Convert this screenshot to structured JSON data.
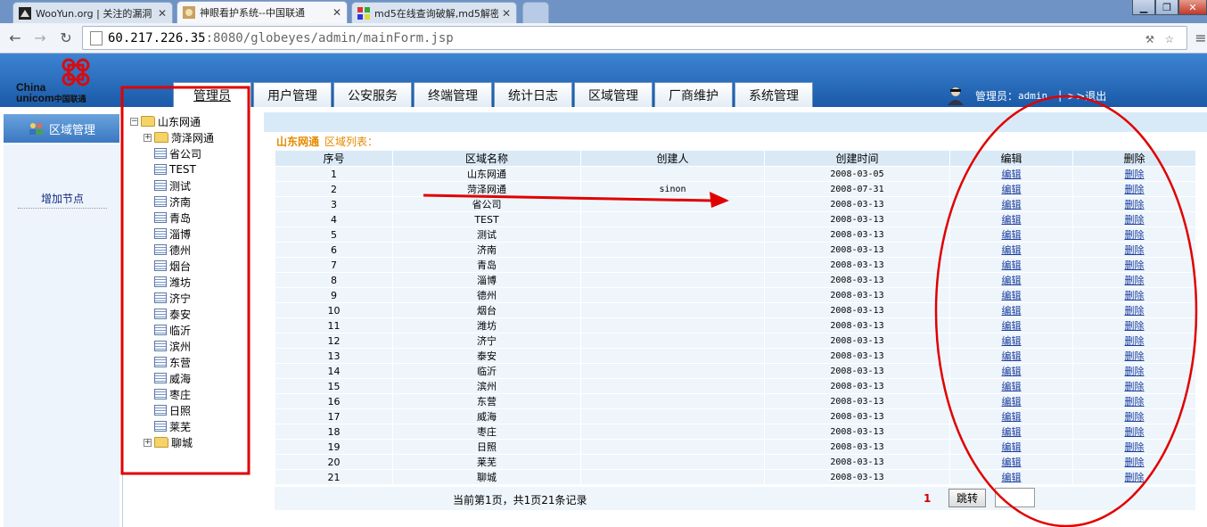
{
  "browser": {
    "tabs": [
      {
        "title": "WooYun.org | 关注的漏洞"
      },
      {
        "title": "神眼看护系统--中国联通"
      },
      {
        "title": "md5在线查询破解,md5解密"
      }
    ],
    "url_host": "60.217.226.35",
    "url_rest": ":8080/globeyes/admin/mainForm.jsp"
  },
  "header": {
    "logo_en_1": "China",
    "logo_en_2": "unicom",
    "logo_cn": "中国联通",
    "nav": [
      "管理员",
      "用户管理",
      "公安服务",
      "终端管理",
      "统计日志",
      "区域管理",
      "厂商维护",
      "系统管理"
    ],
    "user_label": "管理员：",
    "user_name": "admin",
    "separator": "|",
    "logout": ">>退出"
  },
  "sidebar": {
    "title": "区域管理",
    "add_node": "增加节点"
  },
  "tree": {
    "root": "山东网通",
    "children": [
      "菏泽网通",
      "省公司",
      "TEST",
      "测试",
      "济南",
      "青岛",
      "淄博",
      "德州",
      "烟台",
      "潍坊",
      "济宁",
      "泰安",
      "临沂",
      "滨州",
      "东营",
      "威海",
      "枣庄",
      "日照",
      "莱芜",
      "聊城"
    ]
  },
  "main": {
    "title_area": "山东网通",
    "title_sub": "区域列表：",
    "columns": [
      "序号",
      "区域名称",
      "创建人",
      "创建时间",
      "编辑",
      "删除"
    ],
    "edit_label": "编辑",
    "delete_label": "删除",
    "rows": [
      {
        "no": "1",
        "name": "山东网通",
        "creator": "",
        "date": "2008-03-05"
      },
      {
        "no": "2",
        "name": "菏泽网通",
        "creator": "sinon",
        "date": "2008-07-31"
      },
      {
        "no": "3",
        "name": "省公司",
        "creator": "",
        "date": "2008-03-13"
      },
      {
        "no": "4",
        "name": "TEST",
        "creator": "",
        "date": "2008-03-13"
      },
      {
        "no": "5",
        "name": "测试",
        "creator": "",
        "date": "2008-03-13"
      },
      {
        "no": "6",
        "name": "济南",
        "creator": "",
        "date": "2008-03-13"
      },
      {
        "no": "7",
        "name": "青岛",
        "creator": "",
        "date": "2008-03-13"
      },
      {
        "no": "8",
        "name": "淄博",
        "creator": "",
        "date": "2008-03-13"
      },
      {
        "no": "9",
        "name": "德州",
        "creator": "",
        "date": "2008-03-13"
      },
      {
        "no": "10",
        "name": "烟台",
        "creator": "",
        "date": "2008-03-13"
      },
      {
        "no": "11",
        "name": "潍坊",
        "creator": "",
        "date": "2008-03-13"
      },
      {
        "no": "12",
        "name": "济宁",
        "creator": "",
        "date": "2008-03-13"
      },
      {
        "no": "13",
        "name": "泰安",
        "creator": "",
        "date": "2008-03-13"
      },
      {
        "no": "14",
        "name": "临沂",
        "creator": "",
        "date": "2008-03-13"
      },
      {
        "no": "15",
        "name": "滨州",
        "creator": "",
        "date": "2008-03-13"
      },
      {
        "no": "16",
        "name": "东营",
        "creator": "",
        "date": "2008-03-13"
      },
      {
        "no": "17",
        "name": "威海",
        "creator": "",
        "date": "2008-03-13"
      },
      {
        "no": "18",
        "name": "枣庄",
        "creator": "",
        "date": "2008-03-13"
      },
      {
        "no": "19",
        "name": "日照",
        "creator": "",
        "date": "2008-03-13"
      },
      {
        "no": "20",
        "name": "莱芜",
        "creator": "",
        "date": "2008-03-13"
      },
      {
        "no": "21",
        "name": "聊城",
        "creator": "",
        "date": "2008-03-13"
      }
    ],
    "pager": {
      "info": "当前第1页，共1页21条记录",
      "current_page": "1",
      "jump_label": "跳转",
      "page_input": ""
    }
  },
  "annotation_color": "#e00000"
}
